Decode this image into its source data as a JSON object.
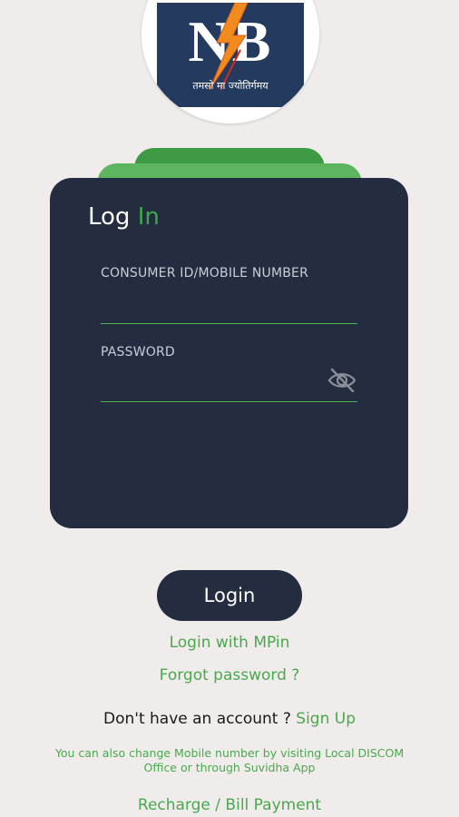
{
  "logo": {
    "letters": "NB",
    "tagline": "तमसो मा ज्योतिर्गमय"
  },
  "card": {
    "title_part1": "Log",
    "title_part2": "In",
    "consumer_label": "CONSUMER ID/MOBILE NUMBER",
    "consumer_value": "",
    "password_label": "PASSWORD",
    "password_value": ""
  },
  "actions": {
    "login_label": "Login",
    "mpin_label": "Login with MPin",
    "forgot_label": "Forgot password ?",
    "no_account_text": "Don't have an account ?",
    "signup_label": "Sign Up",
    "info_text": "You can also change Mobile number by visiting Local DISCOM Office or through Suvidha App",
    "recharge_label": "Recharge / Bill Payment"
  },
  "icons": {
    "password_toggle": "eye-off-icon",
    "logo_bolt": "lightning-bolt-icon"
  },
  "colors": {
    "background": "#f0eceb",
    "card": "#242c40",
    "accent_green": "#4aa84f",
    "tab_dark_green": "#3f9a44",
    "tab_light_green": "#5db55f",
    "logo_navy": "#243a5e",
    "bolt_orange": "#f28a1e"
  }
}
